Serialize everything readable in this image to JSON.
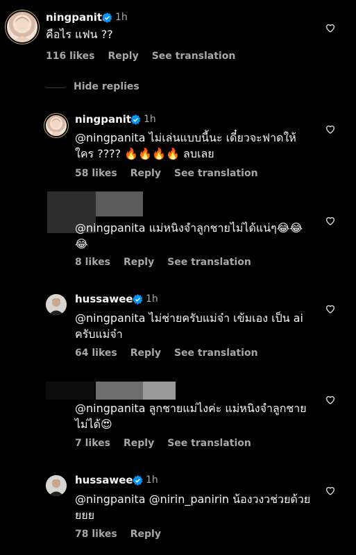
{
  "comments": [
    {
      "username": "ningpanita",
      "time": "1h",
      "text": "คือไร แฟน ??",
      "likes": "116 likes",
      "reply": "Reply",
      "translate": "See translation",
      "avatar": "ningpanita-avatar"
    },
    {
      "username": "ningpanita",
      "time": "1h",
      "text": "@ningpanita ไม่เล่นแบบนี้นะ  เดี๋ยวจะฟาดให้ใคร ???? 🔥🔥🔥🔥 ลบเลย",
      "likes": "58 likes",
      "reply": "Reply",
      "translate": "See translation",
      "avatar": "ningpanita-avatar"
    },
    {
      "username": "",
      "time": "",
      "text": "@ningpanita แม่หนิงจำลูกชายไม่ได้แน่ๆ😂😂😂",
      "likes": "8 likes",
      "reply": "Reply",
      "translate": "See translation",
      "avatar": "hidden-avatar"
    },
    {
      "username": "hussaweee",
      "time": "1h",
      "text": "@ningpanita ไม่ช่ายครับแม่จ๋า เข้มเอง เป็น ai ครับแม่จ๋า",
      "likes": "64 likes",
      "reply": "Reply",
      "translate": "See translation",
      "avatar": "hussaweee-avatar"
    },
    {
      "username": "",
      "time": "",
      "text": "@ningpanita ลูกชายแม่ไงค่ะ แม่หนิงจำลูกชายไม่ได้😍",
      "likes": "7 likes",
      "reply": "Reply",
      "translate": "See translation",
      "avatar": "hidden-avatar"
    },
    {
      "username": "hussaweee",
      "time": "1h",
      "text": "@ningpanita  @nirin_panirin น้องวงวช่วยด้วยยยย",
      "likes": "78 likes",
      "reply": "Reply",
      "translate": "",
      "avatar": "hussaweee-avatar"
    }
  ],
  "hide_replies": "Hide replies",
  "colors": {
    "background": "#000000",
    "text": "#f5f5f5",
    "muted": "#a8a8a8",
    "verified": "#0095f6"
  }
}
